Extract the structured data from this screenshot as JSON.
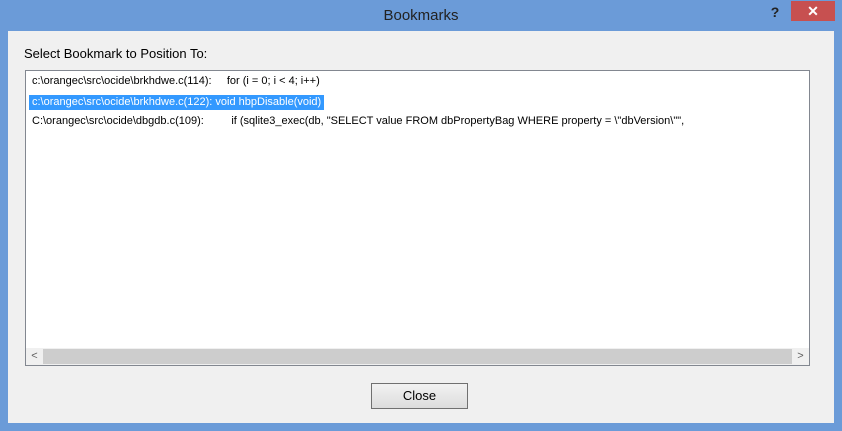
{
  "window": {
    "title": "Bookmarks",
    "help_label": "?",
    "close_label": "✕"
  },
  "dialog": {
    "prompt": "Select Bookmark to Position To:",
    "close_button": "Close"
  },
  "bookmarks": [
    {
      "text": "c:\\orangec\\src\\ocide\\brkhdwe.c(114):     for (i = 0; i < 4; i++)",
      "selected": false
    },
    {
      "text": "c:\\orangec\\src\\ocide\\brkhdwe.c(122): void hbpDisable(void)",
      "selected": true
    },
    {
      "text": "C:\\orangec\\src\\ocide\\dbgdb.c(109):         if (sqlite3_exec(db, \"SELECT value FROM dbPropertyBag WHERE property = \\\"dbVersion\\\"\",",
      "selected": false
    }
  ],
  "scrollbar": {
    "left_arrow": "<",
    "right_arrow": ">"
  },
  "colors": {
    "frame": "#6b9bd8",
    "close_x": "#c75050",
    "selection": "#3399ff"
  }
}
